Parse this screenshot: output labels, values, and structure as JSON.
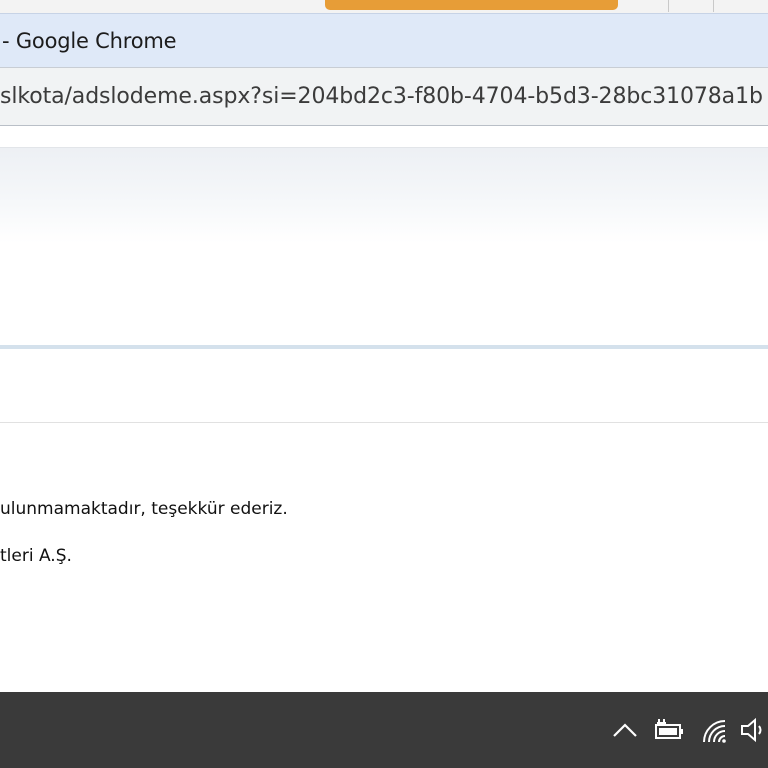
{
  "window": {
    "title": "- Google Chrome"
  },
  "address_bar": {
    "url": "slkota/adslodeme.aspx?si=204bd2c3-f80b-4704-b5d3-28bc31078a1b"
  },
  "page": {
    "message_line_1": "ulunmamaktadır, teşekkür ederiz.",
    "message_line_2": "tleri A.Ş."
  },
  "taskbar": {
    "tray_icons": [
      "chevron-up-icon",
      "battery-charging-icon",
      "wifi-icon",
      "volume-icon"
    ]
  },
  "colors": {
    "accent_orange": "#e79d37",
    "title_bar": "#dfe9f8",
    "taskbar": "#3a3a3a"
  }
}
